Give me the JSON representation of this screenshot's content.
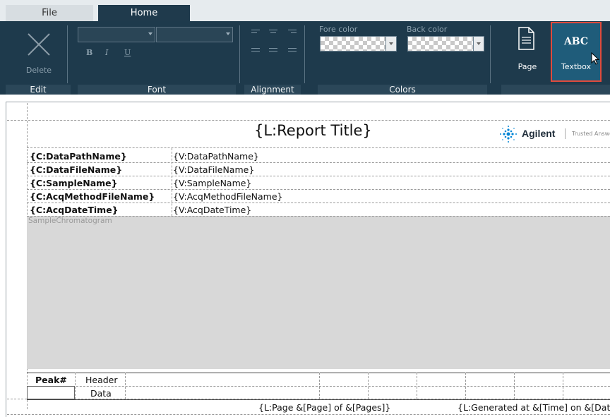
{
  "tabs": {
    "file": "File",
    "home": "Home"
  },
  "ribbon": {
    "edit": {
      "delete_label": "Delete",
      "group_label": "Edit"
    },
    "font": {
      "bold": "B",
      "italic": "I",
      "underline": "U",
      "group_label": "Font"
    },
    "alignment": {
      "group_label": "Alignment"
    },
    "colors": {
      "fore_label": "Fore color",
      "back_label": "Back color",
      "group_label": "Colors"
    },
    "insert": {
      "page_label": "Page",
      "textbox_label": "Textbox",
      "textbox_icon_text": "ABC"
    }
  },
  "report": {
    "title": "{L:Report Title}",
    "logo": {
      "name": "Agilent",
      "tagline": "Trusted Answers"
    },
    "fields": [
      {
        "label": "{C:DataPathName}",
        "value": "{V:DataPathName}"
      },
      {
        "label": "{C:DataFileName}",
        "value": "{V:DataFileName}"
      },
      {
        "label": "{C:SampleName}",
        "value": "{V:SampleName}"
      },
      {
        "label": "{C:AcqMethodFileName}",
        "value": "{V:AcqMethodFileName}"
      },
      {
        "label": "{C:AcqDateTime}",
        "value": "{V:AcqDateTime}"
      }
    ],
    "chromatogram_label": "SampleChromatogram",
    "table": {
      "peak_header": "Peak#",
      "header_label": "Header",
      "data_label": "Data"
    },
    "footer": {
      "page": "{L:Page &[Page] of &[Pages]}",
      "generated": "{L:Generated at &[Time] on &[Date]}"
    }
  },
  "colors": {
    "ribbon_bg": "#1e3a4c",
    "selected_button": "#1f5c7a",
    "selection_outline": "#e04a3c",
    "chart_area": "#d8d8d8",
    "agilent_blue": "#0085d5"
  }
}
